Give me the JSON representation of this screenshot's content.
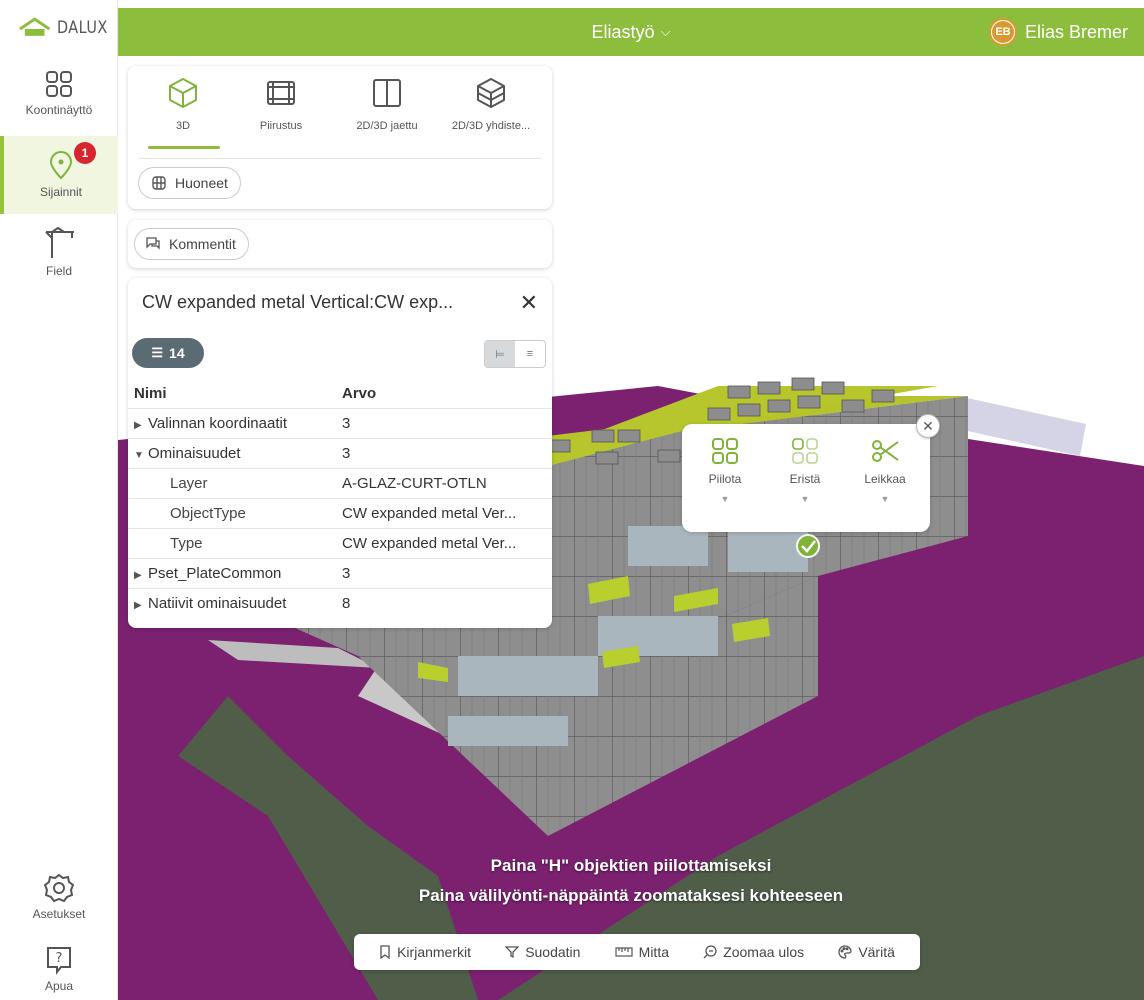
{
  "brand": {
    "name": "DALUX",
    "accent": "#8dbd3c"
  },
  "sidebar": {
    "items": [
      {
        "label": "Koontinäyttö",
        "icon": "dashboard-icon"
      },
      {
        "label": "Sijainnit",
        "icon": "location-pin-icon",
        "badge": "1"
      },
      {
        "label": "Field",
        "icon": "crane-icon"
      }
    ],
    "bottom": [
      {
        "label": "Asetukset",
        "icon": "gear-icon"
      },
      {
        "label": "Apua",
        "icon": "help-icon"
      }
    ]
  },
  "header": {
    "project": "Eliastyö",
    "user_initials": "EB",
    "user_name": "Elias Bremer"
  },
  "view_tabs": [
    {
      "label": "3D",
      "icon": "cube-icon",
      "active": true
    },
    {
      "label": "Piirustus",
      "icon": "drawing-icon"
    },
    {
      "label": "2D/3D jaettu",
      "icon": "split-view-icon"
    },
    {
      "label": "2D/3D yhdiste...",
      "icon": "combined-view-icon"
    }
  ],
  "rooms_chip": "Huoneet",
  "comments_chip": "Kommentit",
  "properties": {
    "title": "CW expanded metal Vertical:CW exp...",
    "count": "14",
    "col_name": "Nimi",
    "col_value": "Arvo",
    "rows": [
      {
        "name": "Valinnan koordinaatit",
        "value": "3",
        "expander": "collapsed"
      },
      {
        "name": "Ominaisuudet",
        "value": "3",
        "expander": "expanded"
      },
      {
        "name": "Layer",
        "value": "A-GLAZ-CURT-OTLN",
        "child": true
      },
      {
        "name": "ObjectType",
        "value": "CW expanded metal Ver...",
        "child": true
      },
      {
        "name": "Type",
        "value": "CW expanded metal Ver...",
        "child": true
      },
      {
        "name": "Pset_PlateCommon",
        "value": "3",
        "expander": "collapsed"
      },
      {
        "name": "Natiivit ominaisuudet",
        "value": "8",
        "expander": "collapsed"
      }
    ]
  },
  "context_menu": {
    "items": [
      {
        "label": "Piilota",
        "icon": "hide-icon"
      },
      {
        "label": "Eristä",
        "icon": "isolate-icon"
      },
      {
        "label": "Leikkaa",
        "icon": "scissors-icon"
      }
    ]
  },
  "hints": [
    "Paina \"H\" objektien piilottamiseksi",
    "Paina välilyönti-näppäintä zoomataksesi kohteeseen"
  ],
  "toolbar": [
    {
      "label": "Kirjanmerkit",
      "icon": "bookmark-icon"
    },
    {
      "label": "Suodatin",
      "icon": "filter-icon"
    },
    {
      "label": "Mitta",
      "icon": "ruler-icon"
    },
    {
      "label": "Zoomaa ulos",
      "icon": "zoom-out-icon"
    },
    {
      "label": "Väritä",
      "icon": "palette-icon"
    }
  ]
}
